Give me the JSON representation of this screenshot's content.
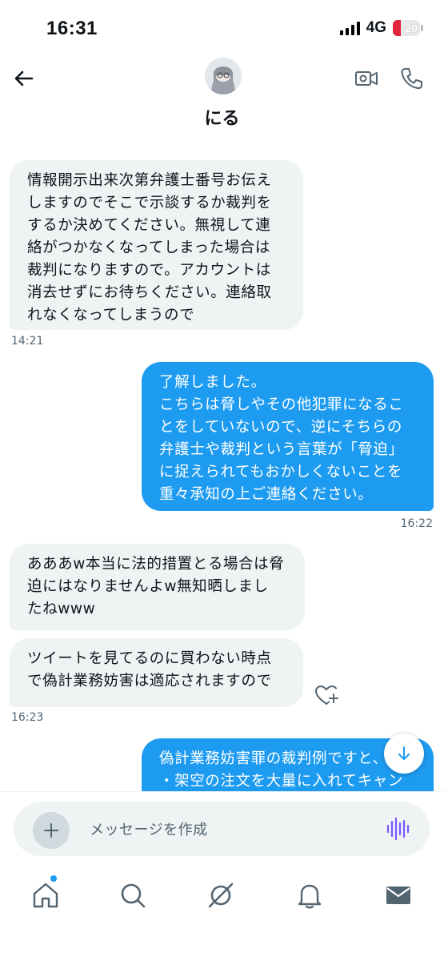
{
  "status_bar": {
    "time": "16:31",
    "network": "4G",
    "battery": "20"
  },
  "header": {
    "name": "にる"
  },
  "messages": [
    {
      "side": "in",
      "text": "情報開示出来次第弁護士番号お伝え\nしますのでそこで示談するか裁判を\nするか決めてください。無視して連\n絡がつかなくなってしまった場合は\n裁判になりますので。アカウントは\n消去せずにお待ちください。連絡取\nれなくなってしまうので"
    },
    {
      "side": "out",
      "text": "了解しました。\nこちらは脅しやその他犯罪になるこ\nとをしていないので、逆にそちらの\n弁護士や裁判という言葉が「脅迫」\nに捉えられてもおかしくないことを\n重々承知の上ご連絡ください。"
    },
    {
      "side": "in",
      "text": "あああw本当に法的措置とる場合は脅\n迫にはなりませんよw無知晒しまし\nたねwww"
    },
    {
      "side": "in",
      "text": "ツイートを見てるのに買わない時点\nで偽計業務妨害は適応されますので"
    },
    {
      "side": "out",
      "text": "偽計業務妨害罪の裁判例ですと、\n・架空の注文を大量に入れてキャン"
    }
  ],
  "timestamps": [
    "14:21",
    "16:22",
    "16:23"
  ],
  "composer": {
    "placeholder": "メッセージを作成"
  },
  "icons": {
    "back": "arrow-left-icon",
    "video": "video-camera-icon",
    "phone": "phone-icon",
    "react": "heart-plus-icon",
    "scroll": "arrow-down-icon",
    "plus": "plus-icon",
    "voice": "voice-wave-icon",
    "nav": [
      "home-icon",
      "search-icon",
      "grok-icon",
      "bell-icon",
      "mail-icon"
    ]
  },
  "colors": {
    "accent": "#1d9bf0",
    "incoming_bg": "#eff3f4",
    "battery_low": "#e0263b",
    "voice": "#7856ff"
  }
}
